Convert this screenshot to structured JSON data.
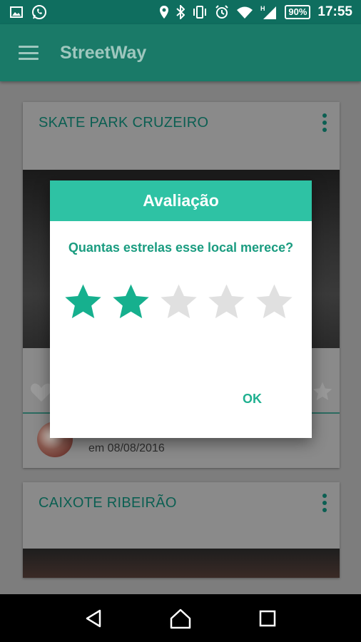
{
  "status_bar": {
    "battery": "90%",
    "time": "17:55",
    "network_type": "H"
  },
  "app_bar": {
    "title": "StreetWay"
  },
  "cards": [
    {
      "title": "SKATE PARK CRUZEIRO",
      "date_text": "em 08/08/2016"
    },
    {
      "title": "CAIXOTE RIBEIRÃO"
    }
  ],
  "dialog": {
    "title": "Avaliação",
    "question": "Quantas estrelas esse local merece?",
    "rating": 2,
    "max_rating": 5,
    "ok_label": "OK"
  },
  "colors": {
    "accent": "#2ec2a4",
    "star_filled": "#16b08e",
    "star_empty": "#e0e0e0",
    "app_bar": "#1a7a68"
  }
}
